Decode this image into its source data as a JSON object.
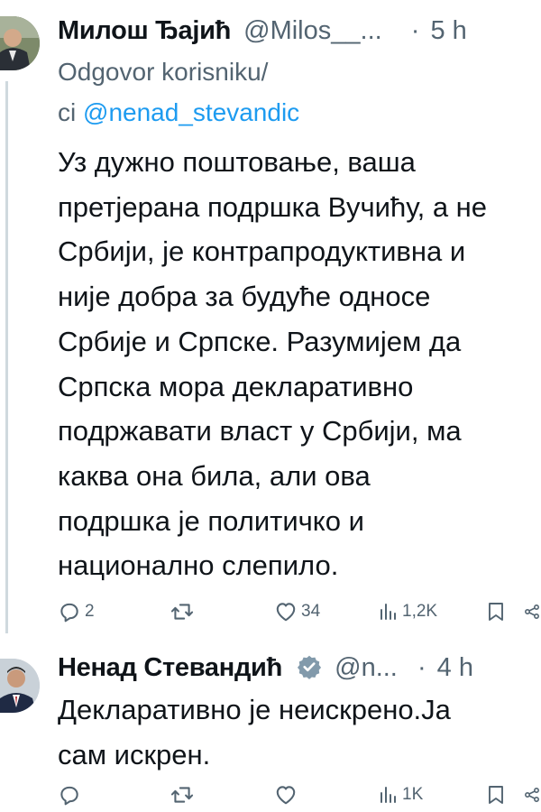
{
  "tweets": [
    {
      "author_name": "Милош Ђајић",
      "handle": "@Milos__...",
      "dot": "·",
      "time": "5 h",
      "reply_prefix": "Odgovor korisniku/",
      "reply_ci": "ci",
      "reply_mention": "@nenad_stevandic",
      "body_lines": [
        "Уз дужно поштовање, ваша",
        "претјерана подршка Вучићу, а не",
        "Србији, је контрапродуктивна и",
        "није добра за будуће односе",
        "Србије и Српске. Разумијем да",
        "Српска мора декларативно",
        "подржавати власт у Србији, ма",
        "каква она била, али ова",
        "подршка је политичко и",
        "национално слепило."
      ],
      "stats": {
        "replies": "2",
        "retweets": "",
        "likes": "34",
        "views": "1,2K"
      }
    },
    {
      "author_name": "Ненад Стевандић",
      "handle": "@n...",
      "dot": "·",
      "time": "4 h",
      "verified": true,
      "body_lines": [
        "Декларативно је неискрено.Ја",
        "сам искрен."
      ],
      "stats": {
        "replies": "",
        "retweets": "",
        "likes": "",
        "views": "1K"
      }
    }
  ],
  "icons": {
    "reply": "reply-icon",
    "retweet": "retweet-icon",
    "like": "heart-icon",
    "views": "views-icon",
    "bookmark": "bookmark-icon",
    "share": "share-icon",
    "verified": "verified-badge-icon"
  },
  "colors": {
    "text": "#0f1419",
    "secondary": "#536471",
    "link": "#1d9bf0",
    "verified": "#829aab"
  }
}
